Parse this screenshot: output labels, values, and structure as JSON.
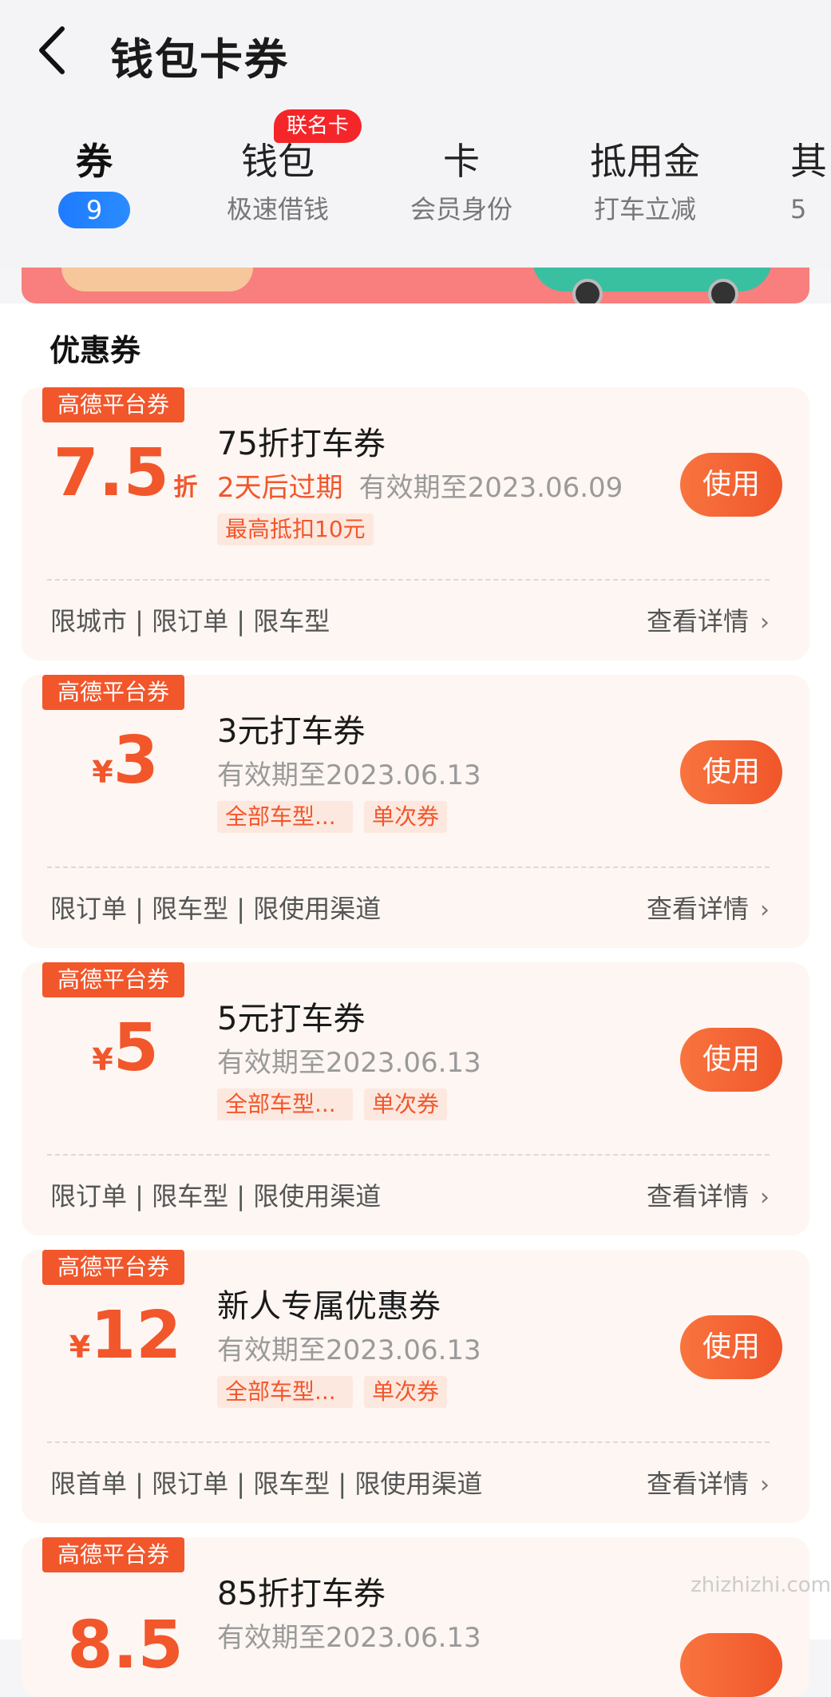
{
  "header": {
    "title": "钱包卡券"
  },
  "tabs": [
    {
      "label": "券",
      "count": "9"
    },
    {
      "label": "钱包",
      "sub": "极速借钱",
      "badge": "联名卡"
    },
    {
      "label": "卡",
      "sub": "会员身份"
    },
    {
      "label": "抵用金",
      "sub": "打车立减"
    },
    {
      "label": "其",
      "sub": "5"
    }
  ],
  "section": {
    "title": "优惠券"
  },
  "coupons": [
    {
      "badge": "高德平台券",
      "symbol": "",
      "value": "7.5",
      "unit": "折",
      "name": "75折打车券",
      "warn": "2天后过期",
      "validity": "有效期至2023.06.09",
      "chips": [
        "最高抵扣10元"
      ],
      "restrictions": "限城市 | 限订单 | 限车型",
      "detail": "查看详情",
      "button": "使用"
    },
    {
      "badge": "高德平台券",
      "symbol": "¥",
      "value": "3",
      "unit": "",
      "name": "3元打车券",
      "warn": "",
      "validity": "有效期至2023.06.13",
      "chips": [
        "全部车型...",
        "单次券"
      ],
      "restrictions": "限订单 | 限车型 | 限使用渠道",
      "detail": "查看详情",
      "button": "使用"
    },
    {
      "badge": "高德平台券",
      "symbol": "¥",
      "value": "5",
      "unit": "",
      "name": "5元打车券",
      "warn": "",
      "validity": "有效期至2023.06.13",
      "chips": [
        "全部车型...",
        "单次券"
      ],
      "restrictions": "限订单 | 限车型 | 限使用渠道",
      "detail": "查看详情",
      "button": "使用"
    },
    {
      "badge": "高德平台券",
      "symbol": "¥",
      "value": "12",
      "unit": "",
      "name": "新人专属优惠券",
      "warn": "",
      "validity": "有效期至2023.06.13",
      "chips": [
        "全部车型...",
        "单次券"
      ],
      "restrictions": "限首单 | 限订单 | 限车型 | 限使用渠道",
      "detail": "查看详情",
      "button": "使用"
    },
    {
      "badge": "高德平台券",
      "symbol": "",
      "value": "8.5",
      "unit": "",
      "name": "85折打车券",
      "warn": "",
      "validity": "有效期至2023.06.13",
      "chips": [],
      "restrictions": "",
      "detail": "",
      "button": ""
    }
  ],
  "watermark": "zhizhizhi.com",
  "colors": {
    "accent": "#f2562b",
    "tab_pill": "#1e7bff",
    "badge_red": "#f4262a"
  }
}
